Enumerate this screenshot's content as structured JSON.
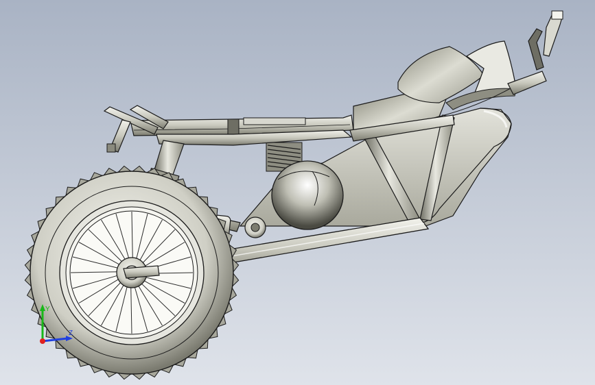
{
  "viewport": {
    "background_top": "#a9b3c4",
    "background_bottom": "#dfe3ea"
  },
  "model": {
    "name": "motorcycle-frame-assembly",
    "shade_light": "#e9e9e2",
    "shade_mid": "#b9b9ad",
    "shade_dark": "#55554c",
    "edge_color": "#1a1a1a"
  },
  "triad": {
    "y_label": "Y",
    "z_label": "Z",
    "x_color": "#e02020",
    "y_color": "#18b818",
    "z_color": "#2040e0"
  }
}
